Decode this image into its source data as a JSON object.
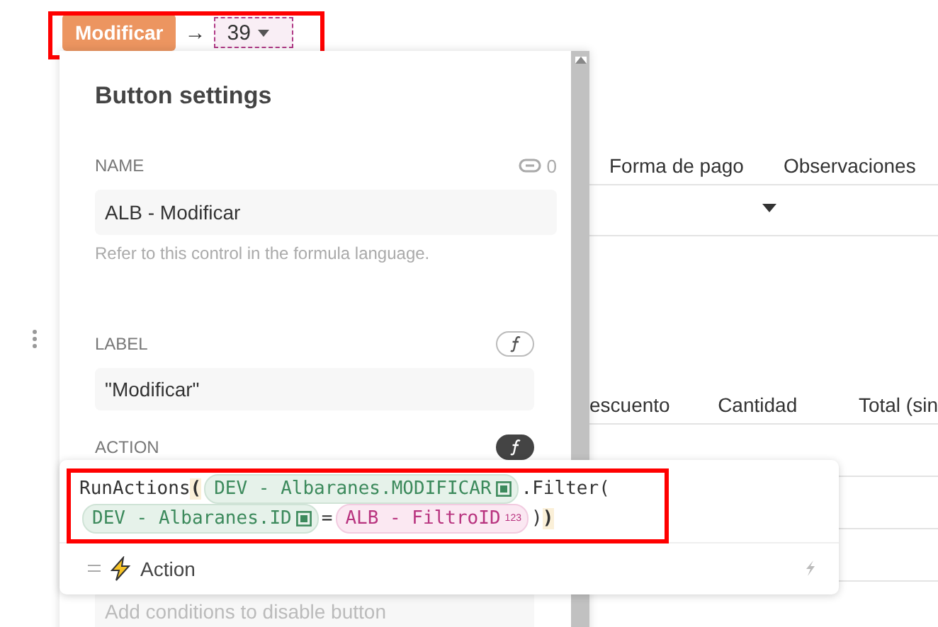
{
  "top_bar": {
    "button_label": "Modificar",
    "arrow": "→",
    "value": "39"
  },
  "background_table_1": {
    "columns": [
      "Forma de pago",
      "Observaciones"
    ]
  },
  "background_table_2": {
    "columns": [
      "escuento",
      "Cantidad",
      "Total (sin"
    ]
  },
  "settings_panel": {
    "title": "Button settings",
    "name_field": {
      "label": "NAME",
      "link_count": "0",
      "value": "ALB - Modificar",
      "hint": "Refer to this control in the formula language."
    },
    "label_field": {
      "label": "LABEL",
      "value": "\"Modificar\"",
      "formula_active": false
    },
    "action_field": {
      "label": "ACTION",
      "formula_active": true,
      "formula_lines": [
        [
          {
            "kind": "text",
            "text": "RunActions"
          },
          {
            "kind": "paren",
            "text": "("
          },
          {
            "kind": "ref",
            "text": "DEV - Albaranes.MODIFICAR"
          },
          {
            "kind": "text",
            "text": ".Filter("
          }
        ],
        [
          {
            "kind": "ref",
            "text": "DEV - Albaranes.ID"
          },
          {
            "kind": "text",
            "text": "="
          },
          {
            "kind": "param",
            "text": "ALB - FiltroID",
            "badge": "123"
          },
          {
            "kind": "text",
            "text": ")"
          },
          {
            "kind": "paren",
            "text": ")"
          }
        ]
      ],
      "suggestion": "Action"
    },
    "disable_field": {
      "placeholder": "Add conditions to disable button"
    }
  }
}
